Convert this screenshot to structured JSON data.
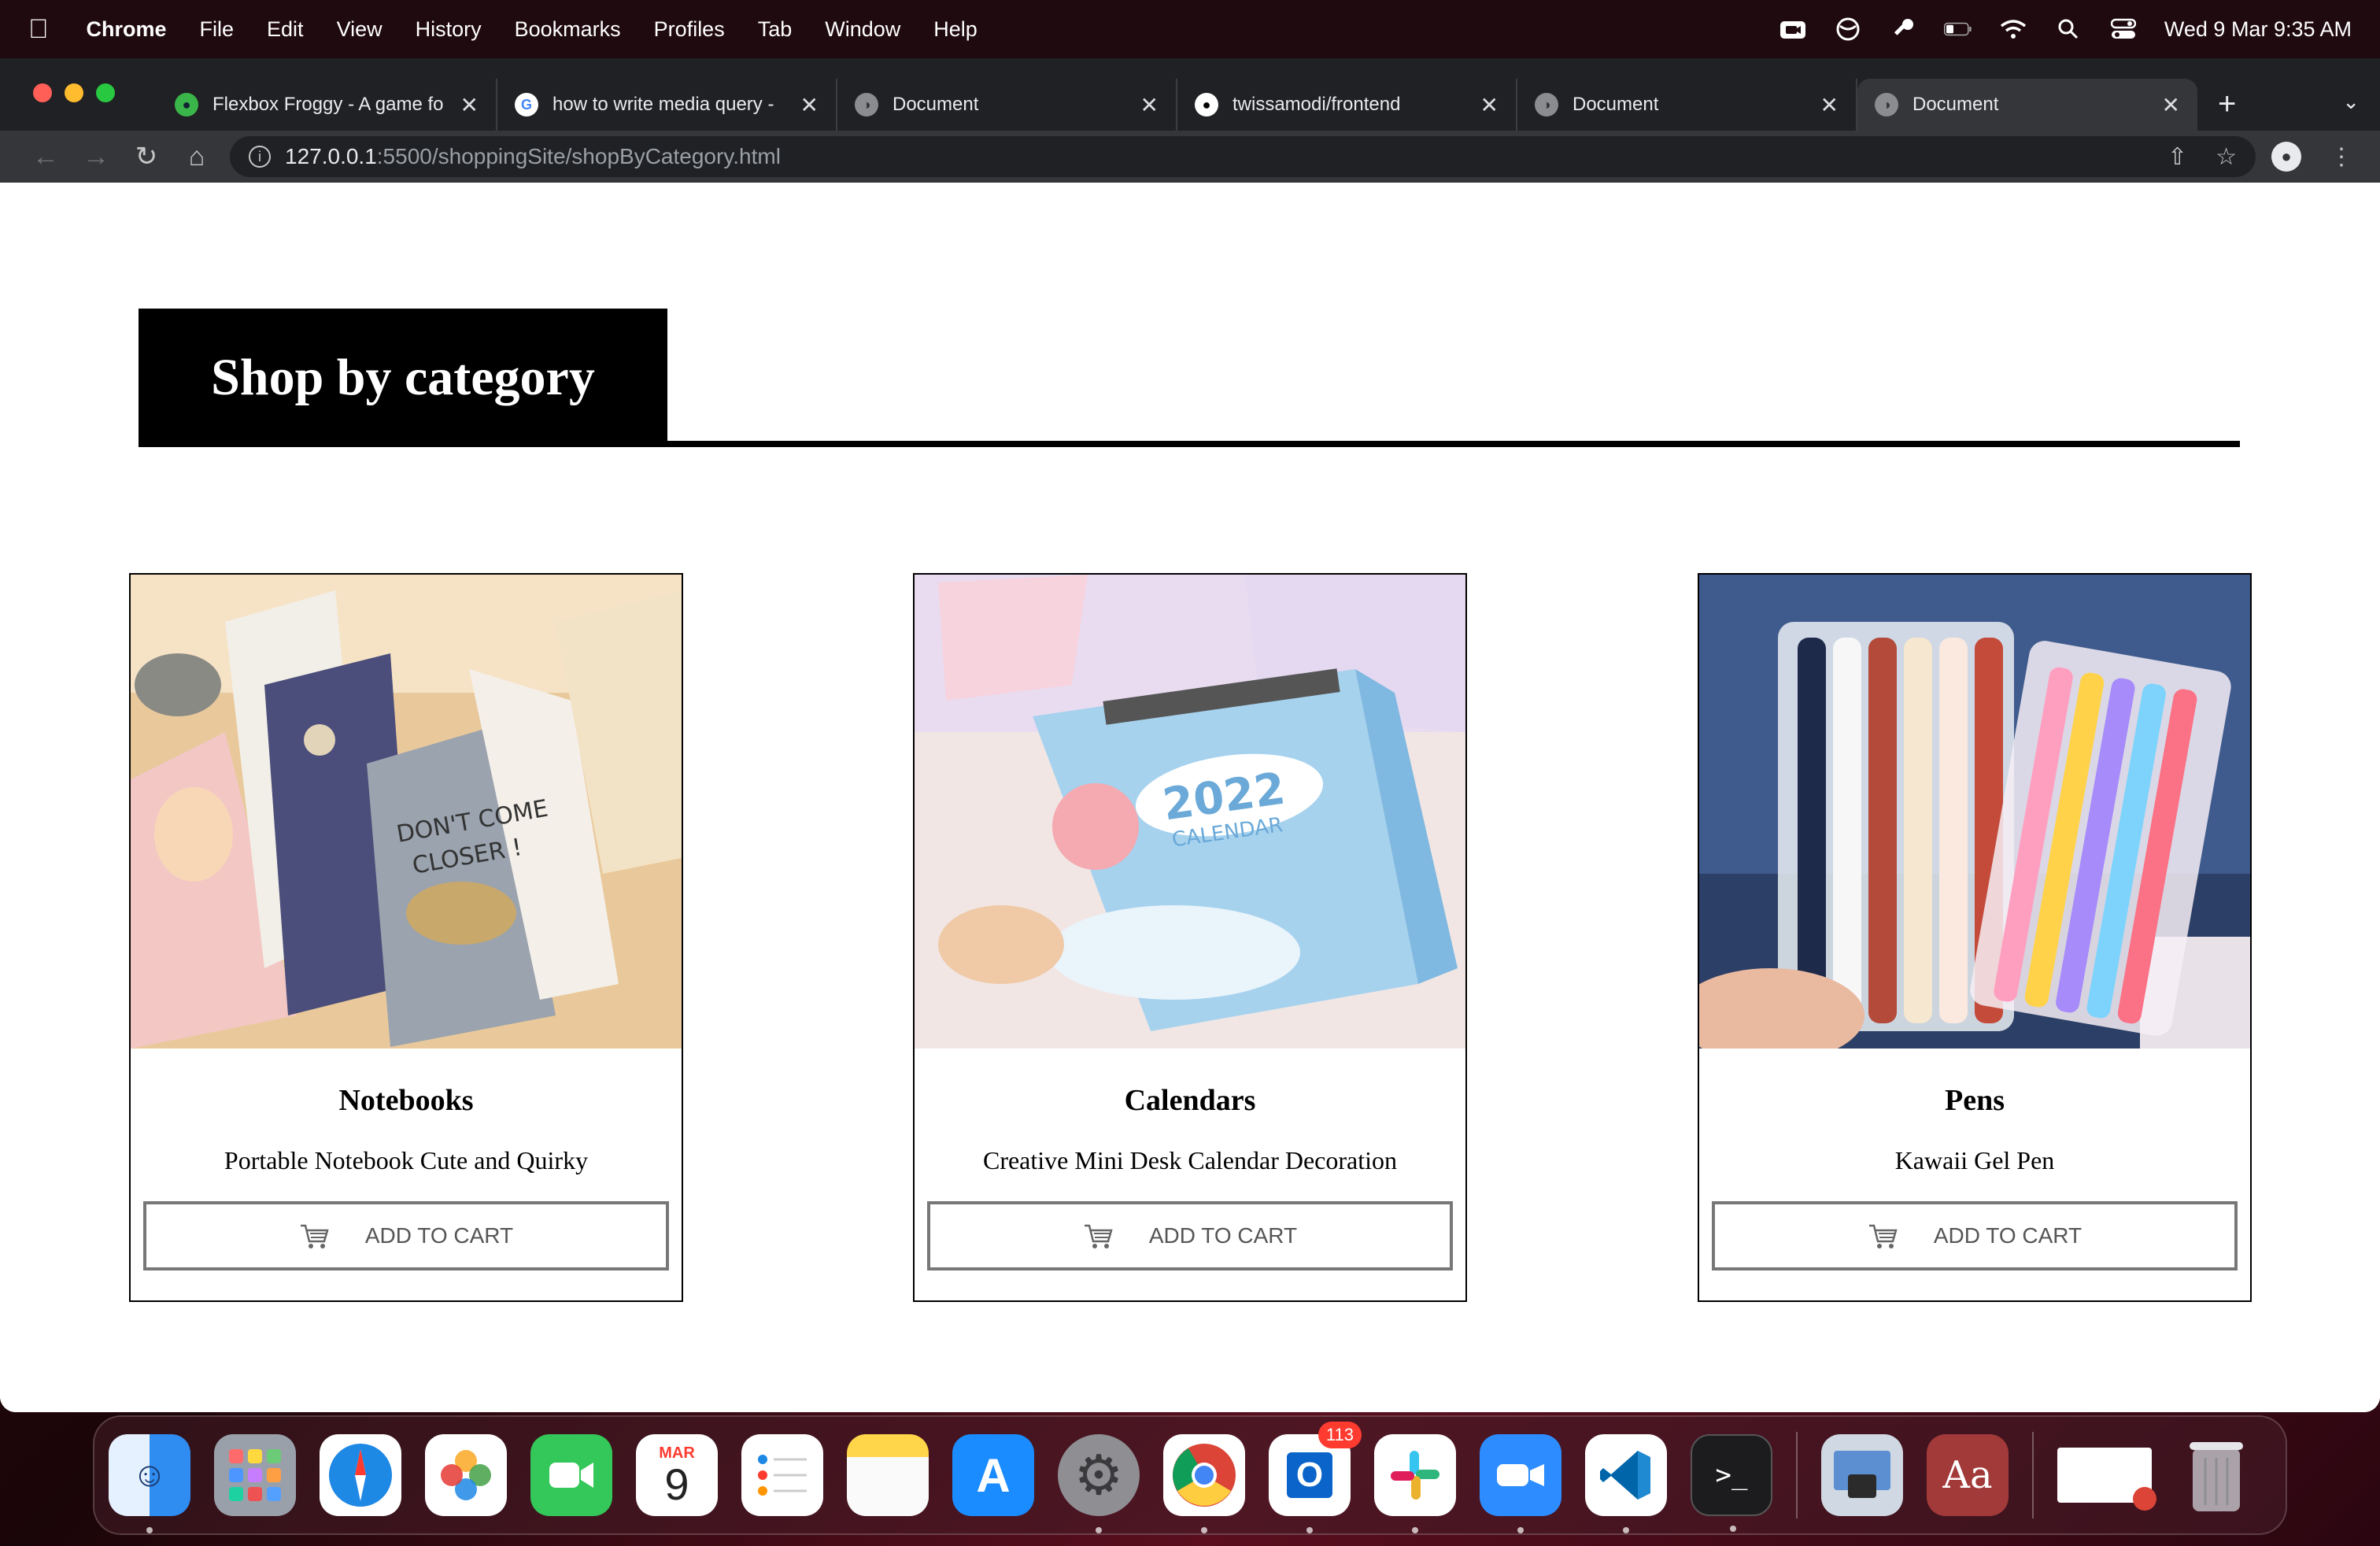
{
  "menubar": {
    "app_name": "Chrome",
    "items": [
      "File",
      "Edit",
      "View",
      "History",
      "Bookmarks",
      "Profiles",
      "Tab",
      "Window",
      "Help"
    ],
    "clock": "Wed 9 Mar  9:35 AM"
  },
  "browser": {
    "tabs": [
      {
        "title": "Flexbox Froggy - A game fo",
        "icon": "frog-icon"
      },
      {
        "title": "how to write media query -",
        "icon": "google-icon"
      },
      {
        "title": "Document",
        "icon": "globe-icon"
      },
      {
        "title": "twissamodi/frontend",
        "icon": "github-icon"
      },
      {
        "title": "Document",
        "icon": "globe-icon"
      },
      {
        "title": "Document",
        "icon": "globe-icon"
      }
    ],
    "active_tab": 5,
    "url_host": "127.0.0.1",
    "url_path": ":5500/shoppingSite/shopByCategory.html"
  },
  "page": {
    "section_title": "Shop by category",
    "products": [
      {
        "name": "Notebooks",
        "description": "Portable Notebook Cute and Quirky",
        "button_label": "ADD TO CART"
      },
      {
        "name": "Calendars",
        "description": "Creative Mini Desk Calendar Decoration",
        "button_label": "ADD TO CART"
      },
      {
        "name": "Pens",
        "description": "Kawaii Gel Pen",
        "button_label": "ADD TO CART"
      }
    ]
  },
  "dock": {
    "apps": [
      "Finder",
      "Launchpad",
      "Safari",
      "Photos",
      "FaceTime",
      "Calendar",
      "Reminders",
      "Notes",
      "App Store",
      "System Preferences",
      "Chrome",
      "Outlook",
      "Slack",
      "Zoom",
      "VS Code",
      "Terminal",
      "Preview",
      "Dictionary",
      "Chrome Window",
      "Trash"
    ],
    "calendar_month": "MAR",
    "calendar_day": "9",
    "outlook_badge": "113",
    "dictionary_label": "Aa"
  },
  "colors": {
    "tabstrip": "#202124",
    "toolbar": "#35363a",
    "accent_black": "#000000",
    "button_border": "#777777"
  }
}
